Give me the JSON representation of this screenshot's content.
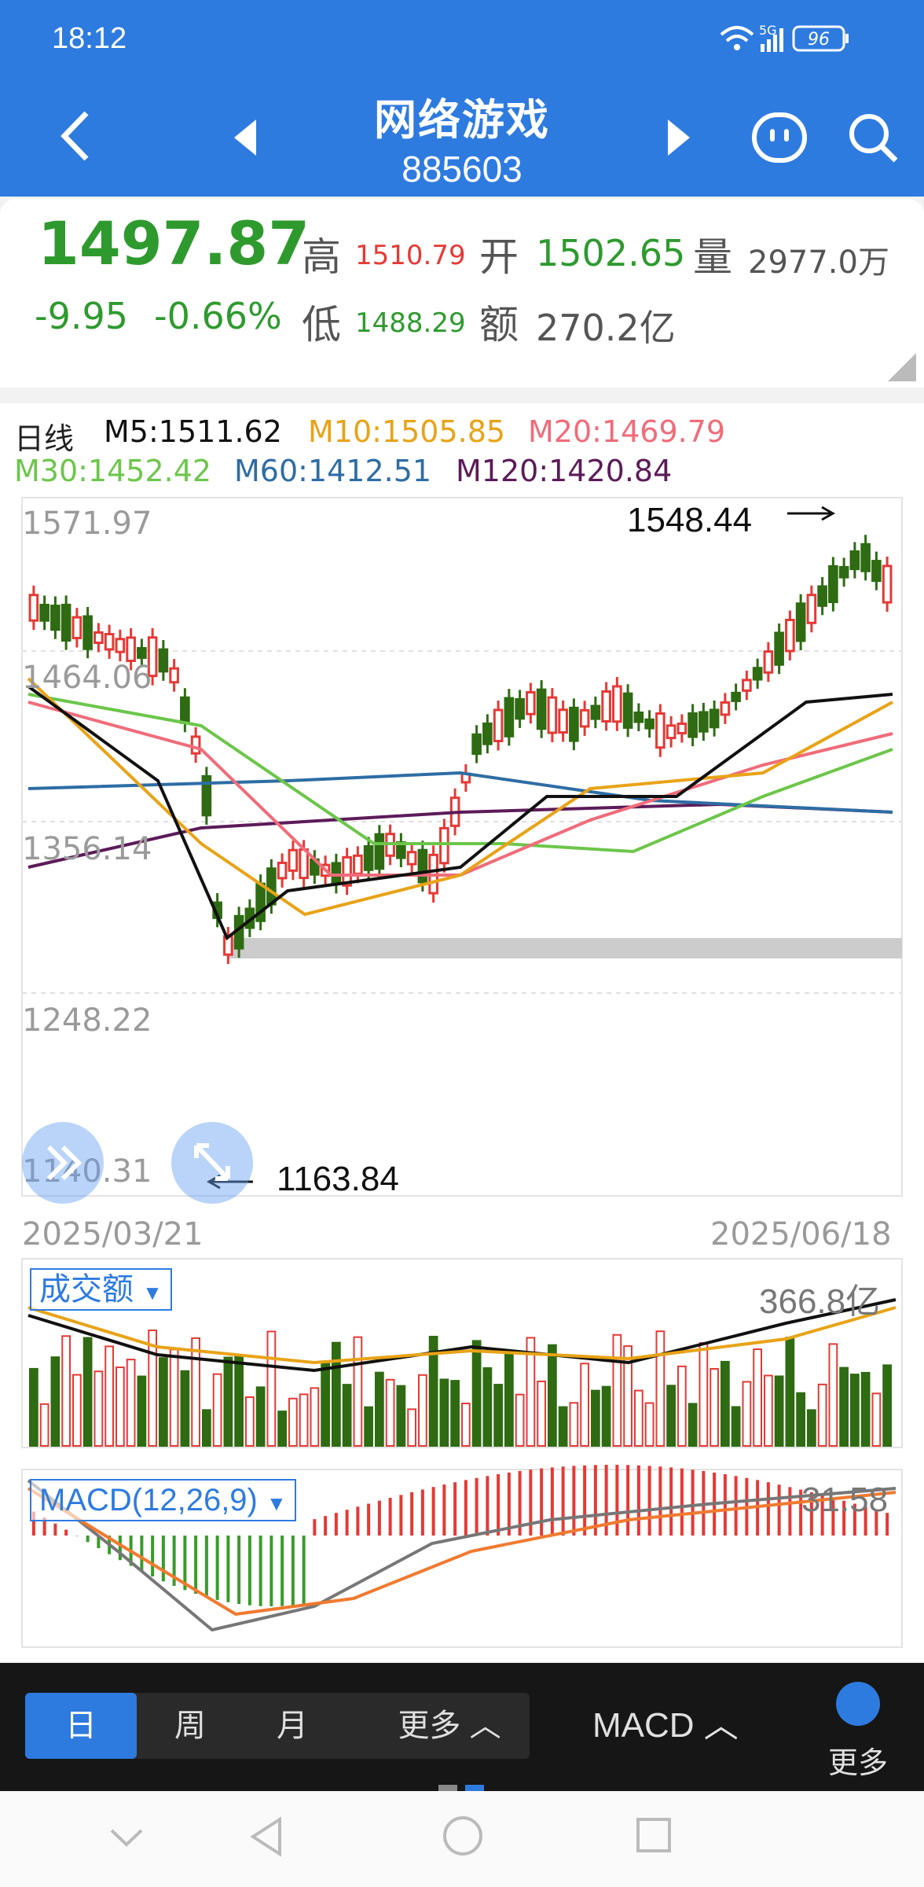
{
  "status_bar": {
    "time": "18:12",
    "battery": "96",
    "signal_label": "5G"
  },
  "header": {
    "title": "网络游戏",
    "code": "885603"
  },
  "quote": {
    "price": "1497.87",
    "change": "-9.95",
    "change_pct": "-0.66%",
    "high_label": "高",
    "high": "1510.79",
    "low_label": "低",
    "low": "1488.29",
    "open_label": "开",
    "open": "1502.65",
    "volume_label": "量",
    "volume": "2977.0万",
    "amount_label": "额",
    "amount": "270.2亿"
  },
  "ma": {
    "period_label": "日线",
    "m5": "M5:1511.62",
    "m10": "M10:1505.85",
    "m20": "M20:1469.79",
    "m30": "M30:1452.42",
    "m60": "M60:1412.51",
    "m120": "M120:1420.84"
  },
  "colors": {
    "up": "#e53935",
    "down": "#2e6b12",
    "m5": "#111111",
    "m10": "#e8a317",
    "m20": "#f06c7a",
    "m30": "#6cc64a",
    "m60": "#2e6da4",
    "m120": "#5c1b59",
    "accent": "#2e7be0"
  },
  "price_axis": [
    "1571.97",
    "1464.06",
    "1356.14",
    "1248.22",
    "1140.31"
  ],
  "annotations": {
    "high_mark": "1548.44",
    "low_mark": "1163.84"
  },
  "dates": {
    "start": "2025/03/21",
    "end": "2025/06/18"
  },
  "volume": {
    "indicator": "成交额",
    "max": "366.8亿"
  },
  "macd": {
    "indicator": "MACD(12,26,9)",
    "value": "31.58"
  },
  "bottom": {
    "periods": [
      "日",
      "周",
      "月",
      "更多"
    ],
    "indicator_button": "MACD",
    "more_label": "更多"
  }
}
